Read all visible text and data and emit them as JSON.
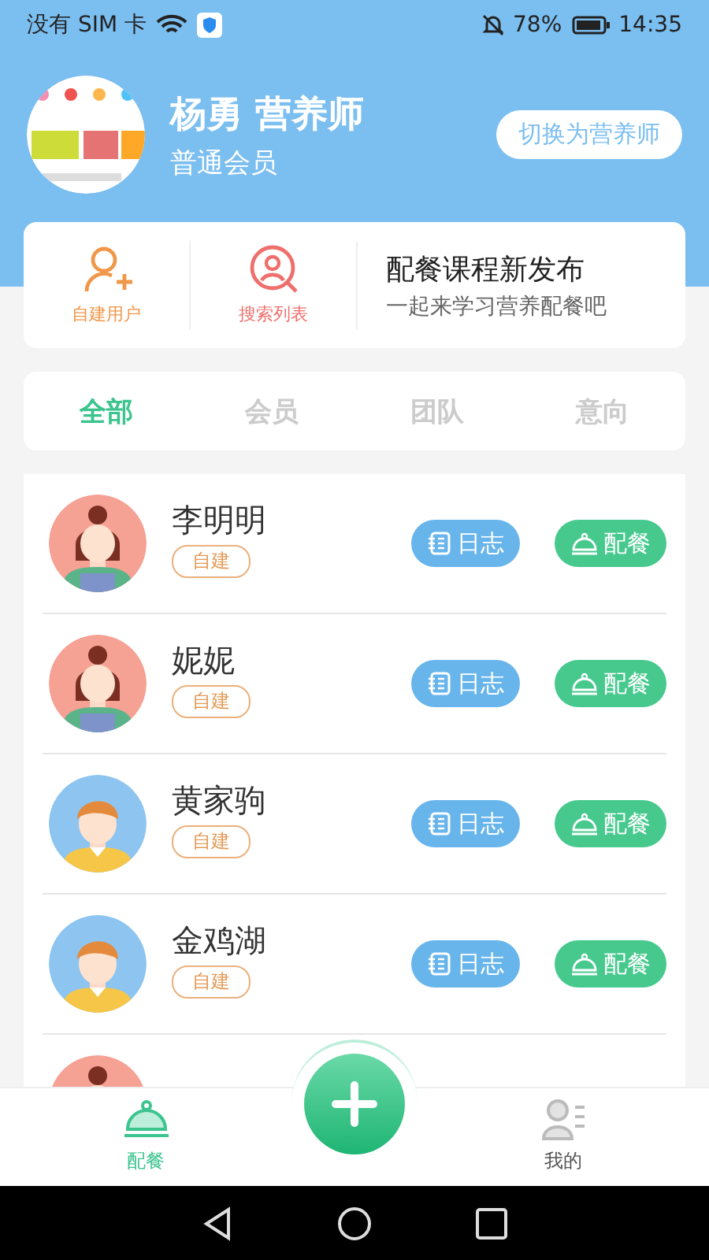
{
  "status_bar": {
    "carrier": "没有 SIM 卡",
    "battery": "78%",
    "time": "14:35"
  },
  "profile": {
    "name": "杨勇 营养师",
    "level": "普通会员",
    "switch_button": "切换为营养师"
  },
  "quick_actions": [
    {
      "label": "自建用户",
      "kind": "add-user"
    },
    {
      "label": "搜索列表",
      "kind": "search-user"
    }
  ],
  "promo": {
    "title": "配餐课程新发布",
    "subtitle": "一起来学习营养配餐吧"
  },
  "tabs": [
    {
      "label": "全部",
      "selected": true
    },
    {
      "label": "会员",
      "selected": false
    },
    {
      "label": "团队",
      "selected": false
    },
    {
      "label": "意向",
      "selected": false
    }
  ],
  "users": [
    {
      "name": "李明明",
      "kind": "female",
      "tag": "自建",
      "log_button": "日志",
      "meal_button": "配餐"
    },
    {
      "name": "妮妮",
      "kind": "female",
      "tag": "自建",
      "log_button": "日志",
      "meal_button": "配餐"
    },
    {
      "name": "黄家驹",
      "kind": "male",
      "tag": "自建",
      "log_button": "日志",
      "meal_button": "配餐"
    },
    {
      "name": "金鸡湖",
      "kind": "male",
      "tag": "自建",
      "log_button": "日志",
      "meal_button": "配餐"
    },
    {
      "kind": "female"
    }
  ],
  "bottom_nav": [
    {
      "label": "配餐",
      "kind": "meal",
      "selected": true
    },
    {
      "kind": "add"
    },
    {
      "label": "我的",
      "kind": "profile",
      "selected": false
    }
  ]
}
